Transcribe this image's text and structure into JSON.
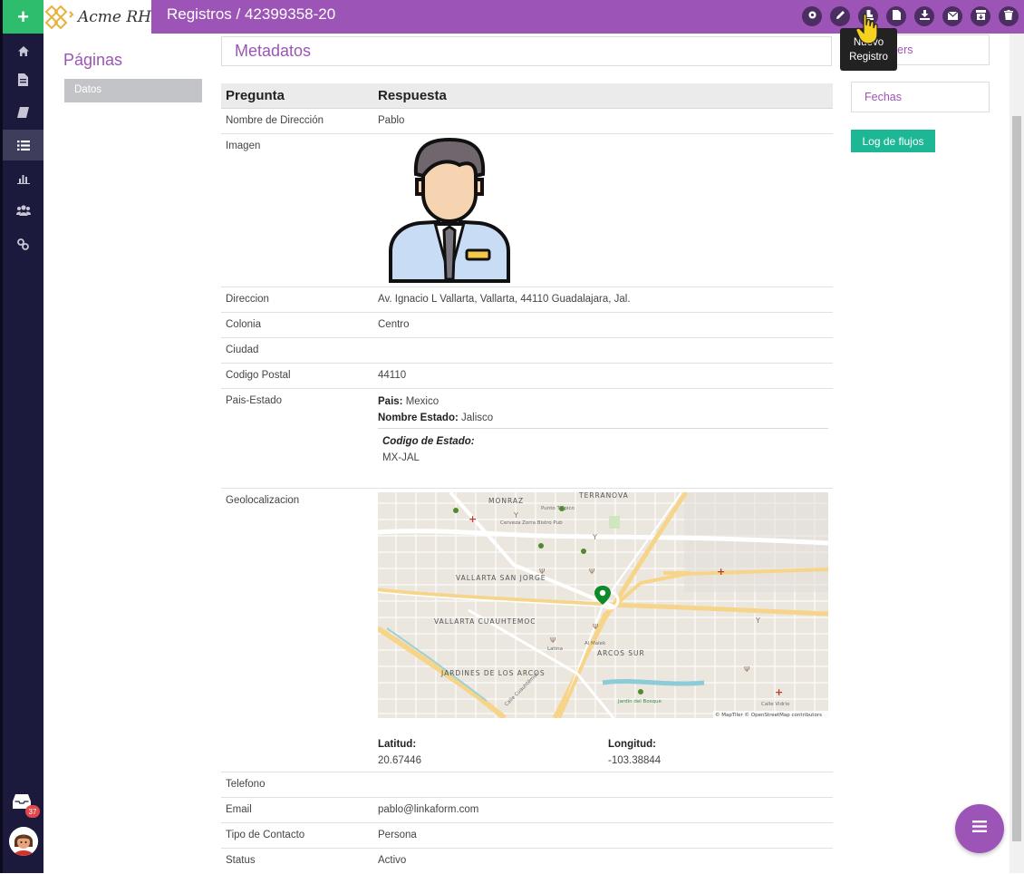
{
  "app": {
    "logo_text": "Acme RH",
    "page_title": "Registros / 42399358-20"
  },
  "tooltip": {
    "line1": "Nuevo",
    "line2": "Registro"
  },
  "rail": {
    "inbox_count": "37"
  },
  "pages_panel": {
    "title": "Páginas",
    "items": [
      "Datos"
    ]
  },
  "main": {
    "section_title": "Metadatos",
    "table": {
      "col_question": "Pregunta",
      "col_answer": "Respuesta",
      "rows": [
        {
          "q": "Nombre de Dirección",
          "a": "Pablo"
        },
        {
          "q": "Imagen"
        },
        {
          "q": "Direccion",
          "a": "Av. Ignacio L Vallarta, Vallarta, 44110 Guadalajara, Jal."
        },
        {
          "q": "Colonia",
          "a": "Centro"
        },
        {
          "q": "Ciudad",
          "a": ""
        },
        {
          "q": "Codigo Postal",
          "a": "44110"
        },
        {
          "q": "Pais-Estado",
          "pais_label": "Pais:",
          "pais_value": "Mexico",
          "estado_label": "Nombre Estado:",
          "estado_value": "Jalisco",
          "codigo_label": "Codigo de Estado:",
          "codigo_value": "MX-JAL"
        },
        {
          "q": "Geolocalizacion",
          "lat_label": "Latitud:",
          "lat_value": "20.67446",
          "lon_label": "Longitud:",
          "lon_value": "-103.38844"
        },
        {
          "q": "Telefono",
          "a": ""
        },
        {
          "q": "Email",
          "a": "pablo@linkaform.com"
        },
        {
          "q": "Tipo de Contacto",
          "a": "Persona"
        },
        {
          "q": "Status",
          "a": "Activo"
        }
      ]
    },
    "map": {
      "labels": [
        "MONRAZ",
        "TERRANOVA",
        "VALLARTA SAN JORGE",
        "VALLARTA CUAUHTEMOC",
        "ARCOS SUR",
        "JARDINES DE LOS ARCOS"
      ],
      "places": [
        "Cerveza Zorra Bistro Pub",
        "Punto Trópico",
        "Al Malek",
        "Latina",
        "Jardín del Bosque",
        "Calle Vidrio",
        "Calle Cuauhtémoc"
      ],
      "attribution": "© MapTiler © OpenStreetMap contributors"
    }
  },
  "sidebar_right": {
    "followers": "Followers",
    "dates": "Fechas",
    "log_button": "Log de flujos"
  },
  "colors": {
    "brand": "#9c55b6",
    "accent_green": "#2ebd6c",
    "teal": "#1eb796",
    "rail": "#1b1a3c"
  },
  "icons": {
    "rail": [
      "home-icon",
      "file-icon",
      "book-icon",
      "list-icon",
      "bar-chart-icon",
      "users-icon",
      "link-icon",
      "inbox-icon"
    ],
    "toolbar": [
      "gear-icon",
      "pencil-icon",
      "stamp-icon",
      "document-icon",
      "download-icon",
      "envelope-icon",
      "archive-icon",
      "trash-icon"
    ]
  }
}
